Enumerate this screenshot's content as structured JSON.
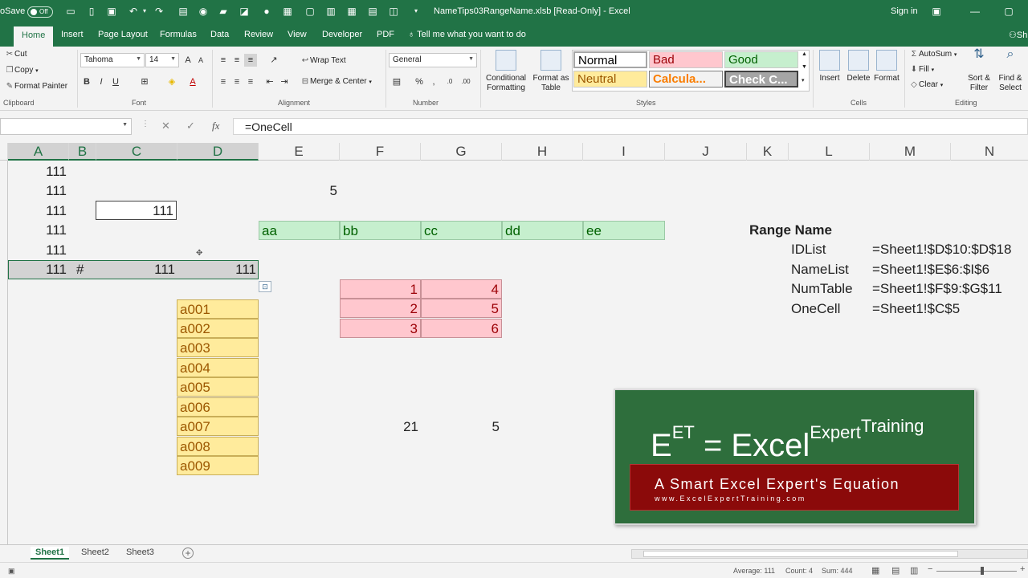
{
  "titlebar": {
    "autosave_label": "oSave",
    "autosave_state": "Off",
    "filename": "NameTips03RangeName.xlsb  [Read-Only]  -  Excel",
    "signin": "Sign in"
  },
  "ribbon_tabs": [
    "Home",
    "Insert",
    "Page Layout",
    "Formulas",
    "Data",
    "Review",
    "View",
    "Developer",
    "PDF"
  ],
  "tell_me": "Tell me what you want to do",
  "share_label": "Sh",
  "clipboard": {
    "cut": "Cut",
    "copy": "Copy",
    "format_painter": "Format Painter",
    "label": "Clipboard"
  },
  "font": {
    "name": "Tahoma",
    "size": "14",
    "bold": "B",
    "italic": "I",
    "underline": "U",
    "label": "Font"
  },
  "alignment": {
    "wrap_text": "Wrap Text",
    "merge_center": "Merge & Center",
    "label": "Alignment"
  },
  "number": {
    "format": "General",
    "percent": "%",
    "comma": ",",
    "label": "Number"
  },
  "styles": {
    "conditional": "Conditional Formatting",
    "format_table": "Format as Table",
    "normal": "Normal",
    "bad": "Bad",
    "good": "Good",
    "neutral": "Neutral",
    "calculation": "Calcula...",
    "check_cell": "Check C...",
    "label": "Styles"
  },
  "cells": {
    "insert": "Insert",
    "delete": "Delete",
    "format": "Format",
    "label": "Cells"
  },
  "editing": {
    "autosum": "AutoSum",
    "fill": "Fill",
    "clear": "Clear",
    "sort_filter": "Sort & Filter",
    "find_select": "Find & Select",
    "label": "Editing"
  },
  "formula_bar": {
    "name_box": "",
    "cancel": "✕",
    "enter": "✓",
    "fx": "fx",
    "formula": "=OneCell"
  },
  "columns": [
    "A",
    "B",
    "C",
    "D",
    "E",
    "F",
    "G",
    "H",
    "I",
    "J",
    "K",
    "L",
    "M",
    "N"
  ],
  "sheet": {
    "col_a": [
      "111",
      "111",
      "111",
      "111",
      "111",
      "111"
    ],
    "e2": "5",
    "c3": "111",
    "row6": {
      "b": "#",
      "c": "111",
      "d": "111"
    },
    "headers": [
      "aa",
      "bb",
      "cc",
      "dd",
      "ee"
    ],
    "num_f": [
      "1",
      "2",
      "3"
    ],
    "num_g": [
      "4",
      "5",
      "6"
    ],
    "list": [
      "a001",
      "a002",
      "a003",
      "a004",
      "a005",
      "a006",
      "a007",
      "a008",
      "a009"
    ],
    "f14": "21",
    "g14": "5",
    "range_title": "Range Name",
    "range_names": [
      {
        "name": "IDList",
        "ref": "=Sheet1!$D$10:$D$18"
      },
      {
        "name": "NameList",
        "ref": "=Sheet1!$E$6:$I$6"
      },
      {
        "name": "NumTable",
        "ref": "=Sheet1!$F$9:$G$11"
      },
      {
        "name": "OneCell",
        "ref": "=Sheet1!$C$5"
      }
    ]
  },
  "logo": {
    "e": "E",
    "e_sup": "ET",
    "equals": "=",
    "excel": "Excel",
    "expert": "Expert",
    "training": "Training",
    "tagline": "A Smart Excel Expert's Equation",
    "url": "www.ExcelExpertTraining.com"
  },
  "sheet_tabs": [
    "Sheet1",
    "Sheet2",
    "Sheet3"
  ],
  "add_sheet": "+",
  "status": {
    "average": "Average: 111",
    "count": "Count: 4",
    "sum": "Sum: 444"
  }
}
